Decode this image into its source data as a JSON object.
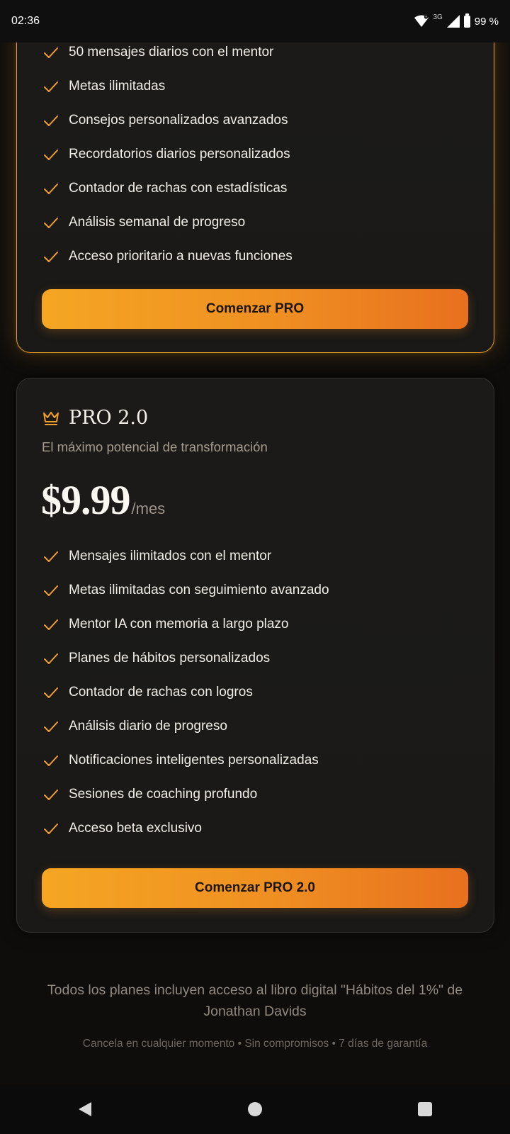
{
  "status_bar": {
    "time": "02:36",
    "network": "3G",
    "battery": "99 %"
  },
  "plan_pro": {
    "features": [
      "50 mensajes diarios con el mentor",
      "Metas ilimitadas",
      "Consejos personalizados avanzados",
      "Recordatorios diarios personalizados",
      "Contador de rachas con estadísticas",
      "Análisis semanal de progreso",
      "Acceso prioritario a nuevas funciones"
    ],
    "cta_label": "Comenzar PRO"
  },
  "plan_pro2": {
    "icon": "crown-icon",
    "name": "PRO 2.0",
    "subtitle": "El máximo potencial de transformación",
    "price": "$9.99",
    "period": "/mes",
    "features": [
      "Mensajes ilimitados con el mentor",
      "Metas ilimitadas con seguimiento avanzado",
      "Mentor IA con memoria a largo plazo",
      "Planes de hábitos personalizados",
      "Contador de rachas con logros",
      "Análisis diario de progreso",
      "Notificaciones inteligentes personalizadas",
      "Sesiones de coaching profundo",
      "Acceso beta exclusivo"
    ],
    "cta_label": "Comenzar PRO 2.0"
  },
  "footer": {
    "note": "Todos los planes incluyen acceso al libro digital \"Hábitos del 1%\" de Jonathan Davids",
    "terms": "Cancela en cualquier momento • Sin compromisos • 7 días de garantía"
  },
  "colors": {
    "accent": "#f5a623",
    "accent_end": "#e8701e",
    "background": "#0e0d0c",
    "card": "#1b1a18"
  }
}
